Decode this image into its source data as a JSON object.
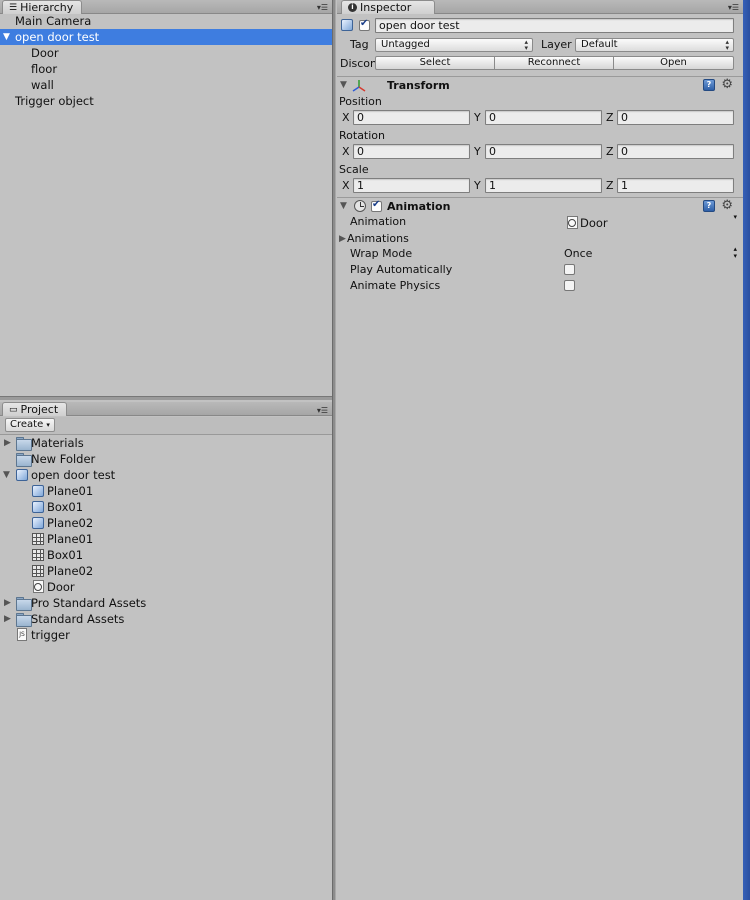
{
  "hierarchy": {
    "tab_label": "Hierarchy",
    "items": [
      {
        "label": "Main Camera"
      },
      {
        "label": "open door test",
        "selected": true,
        "expanded": true
      },
      {
        "label": "Door"
      },
      {
        "label": "floor"
      },
      {
        "label": "wall"
      },
      {
        "label": "Trigger object"
      }
    ]
  },
  "project": {
    "tab_label": "Project",
    "create_label": "Create",
    "items": [
      {
        "label": "Materials",
        "icon": "folder-icon"
      },
      {
        "label": "New Folder",
        "icon": "folder-icon"
      },
      {
        "label": "open door test",
        "icon": "prefab-icon"
      },
      {
        "label": "Plane01",
        "icon": "prefab-icon"
      },
      {
        "label": "Box01",
        "icon": "prefab-icon"
      },
      {
        "label": "Plane02",
        "icon": "prefab-icon"
      },
      {
        "label": "Plane01",
        "icon": "mesh-icon"
      },
      {
        "label": "Box01",
        "icon": "mesh-icon"
      },
      {
        "label": "Plane02",
        "icon": "mesh-icon"
      },
      {
        "label": "Door",
        "icon": "animation-clip-icon"
      },
      {
        "label": "Pro Standard Assets",
        "icon": "folder-icon"
      },
      {
        "label": "Standard Assets",
        "icon": "folder-icon"
      },
      {
        "label": "trigger",
        "icon": "script-icon"
      }
    ]
  },
  "inspector": {
    "tab_label": "Inspector",
    "object_name": "open door test",
    "tag_label": "Tag",
    "tag_value": "Untagged",
    "layer_label": "Layer",
    "layer_value": "Default",
    "prefab_label": "Discon",
    "prefab_buttons": [
      "Select",
      "Reconnect",
      "Open"
    ],
    "transform": {
      "title": "Transform",
      "position_label": "Position",
      "position": {
        "x": "0",
        "y": "0",
        "z": "0"
      },
      "rotation_label": "Rotation",
      "rotation": {
        "x": "0",
        "y": "0",
        "z": "0"
      },
      "scale_label": "Scale",
      "scale": {
        "x": "1",
        "y": "1",
        "z": "1"
      },
      "axis_labels": {
        "x": "X",
        "y": "Y",
        "z": "Z"
      }
    },
    "animation": {
      "title": "Animation",
      "animation_label": "Animation",
      "animation_value": "Door",
      "animations_label": "Animations",
      "wrap_mode_label": "Wrap Mode",
      "wrap_mode_value": "Once",
      "play_auto_label": "Play Automatically",
      "animate_physics_label": "Animate Physics"
    }
  },
  "colors": {
    "selection": "#3e7de0",
    "panel_bg": "#c2c2c2",
    "right_edge": "#2f57ad"
  }
}
